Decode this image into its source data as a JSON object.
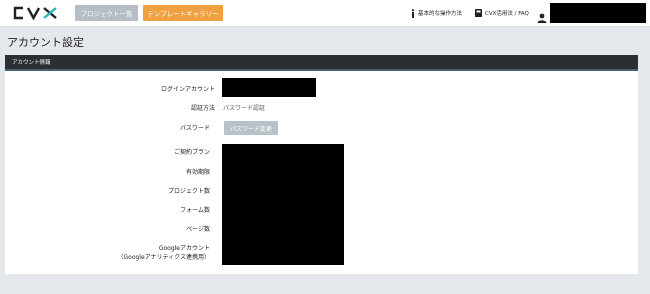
{
  "header": {
    "logo_text": "CVX",
    "projects_button": "プロジェクト一覧",
    "templates_button": "テンプレートギャラリー",
    "manual_link": "基本的な操作方法",
    "faq_link": "CVX活用法 / FAQ",
    "colors": {
      "templates_button": "#f0a040",
      "projects_button": "#b5bec6",
      "logo_accent": "#2bb3c0"
    }
  },
  "page": {
    "title": "アカウント設定"
  },
  "account": {
    "section_title": "アカウント情報",
    "rows": {
      "login": "ログインアカウント",
      "auth_method": "認証方法",
      "auth_value": "パスワード認証",
      "password": "パスワード",
      "password_button": "パスワード変更",
      "plan": "ご契約プラン",
      "expiry": "有効期限",
      "project_count": "プロジェクト数",
      "form_count": "フォーム数",
      "page_count": "ページ数",
      "google_account": "Googleアカウント",
      "google_account_sub": "（Googleアナリティクス連携用）"
    }
  }
}
